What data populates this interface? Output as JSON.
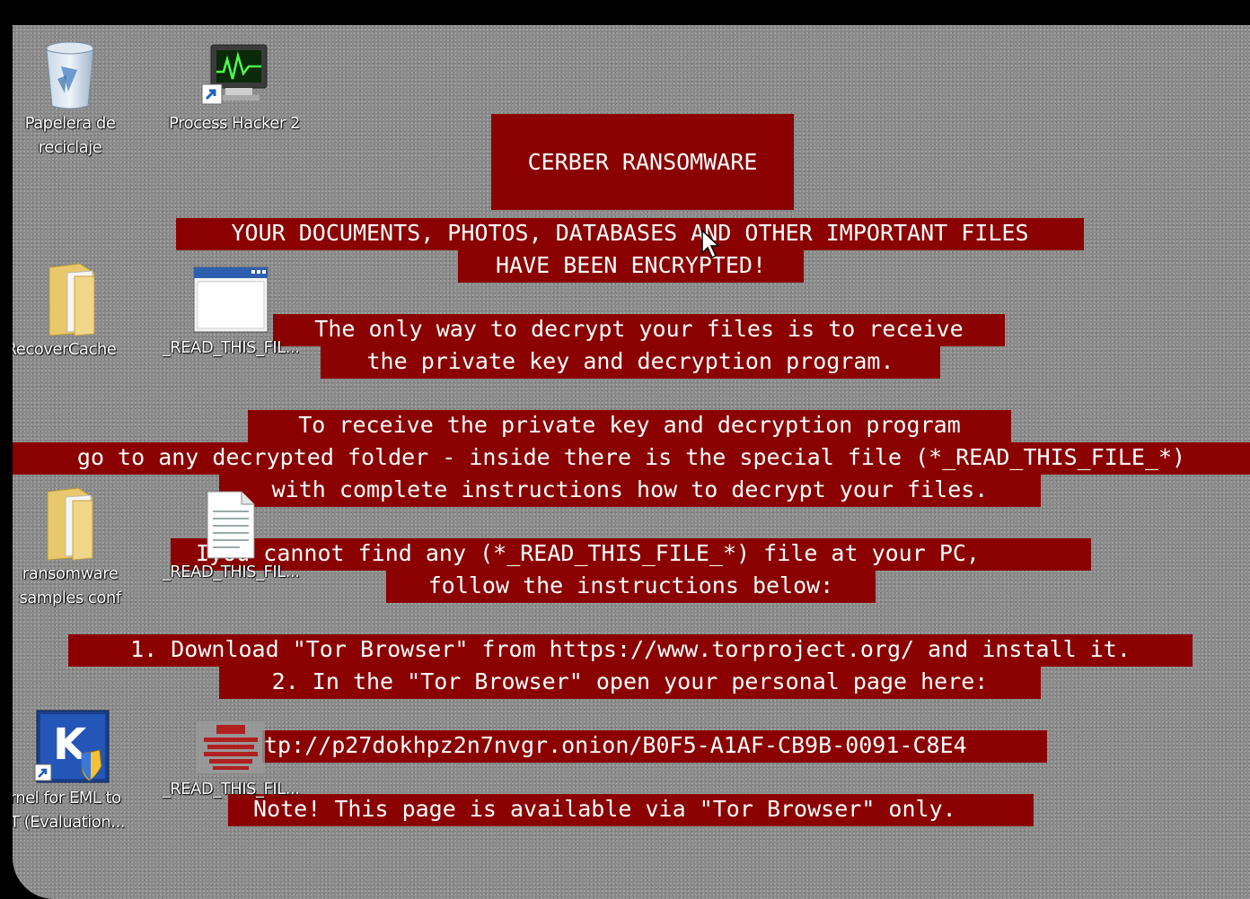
{
  "desktop": {
    "icons": [
      {
        "label_lines": [
          "Papelera de",
          "reciclaje"
        ],
        "icon": "recycle-bin-icon"
      },
      {
        "label_lines": [
          "Process Hacker 2"
        ],
        "icon": "process-hacker-icon"
      },
      {
        "label_lines": [
          "tRecoverCache"
        ],
        "icon": "folder-icon"
      },
      {
        "label_lines": [
          "_READ_THIS_FIL..."
        ],
        "icon": "window-app-icon"
      },
      {
        "label_lines": [
          "ransomware",
          "samples conf"
        ],
        "icon": "folder-icon"
      },
      {
        "label_lines": [
          "_READ_THIS_FIL..."
        ],
        "icon": "text-document-icon"
      },
      {
        "label_lines": [
          "ernel for EML to",
          "ST (Evaluation..."
        ],
        "icon": "kernel-app-icon"
      },
      {
        "label_lines": [
          "_READ_THIS_FIL..."
        ],
        "icon": "html-document-icon"
      }
    ]
  },
  "ransom_note": {
    "title": "CERBER RANSOMWARE",
    "lines": [
      "YOUR DOCUMENTS, PHOTOS, DATABASES AND OTHER IMPORTANT FILES",
      "HAVE BEEN ENCRYPTED!",
      "The only way to decrypt your files is to receive",
      "the private key and decryption program.",
      "To receive the private key and decryption program",
      "go to any decrypted folder - inside there is the special file (*_READ_THIS_FILE_*)",
      "with complete instructions how to decrypt your files.",
      "you cannot find any (*_READ_THIS_FILE_*) file at your PC,",
      "follow the instructions below:",
      "1. Download \"Tor Browser\" from https://www.torproject.org/ and install it.",
      "2. In the \"Tor Browser\" open your personal page here:",
      "tp://p27dokhpz2n7nvgr.onion/B0F5-A1AF-CB9B-0091-C8E4",
      "ote! This page is available via \"Tor Browser\" only."
    ],
    "partial_prefixes": {
      "if_line": "I",
      "url_line": "",
      "note_line": "N"
    }
  },
  "colors": {
    "band": "#8b0000",
    "text": "#ffffff",
    "desktop_bg": "#8a8a8a"
  }
}
